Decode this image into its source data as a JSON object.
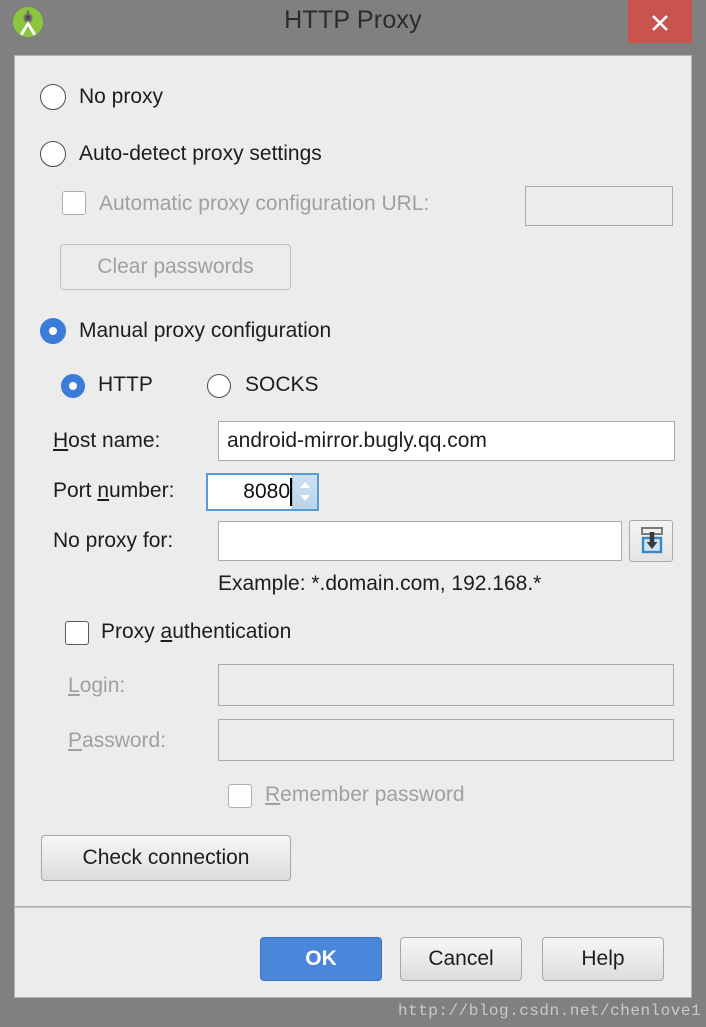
{
  "window": {
    "title": "HTTP Proxy",
    "app_icon": "android-studio-icon",
    "close_label": "×",
    "close_color": "#c9534d",
    "titlebar_color": "#808080",
    "panel_color": "#ececec"
  },
  "options": {
    "no_proxy": {
      "label": "No proxy",
      "checked": false
    },
    "auto_detect": {
      "label": "Auto-detect proxy settings",
      "checked": false
    },
    "auto_config": {
      "label": "Automatic proxy configuration URL:",
      "checked": false,
      "disabled": true,
      "url_value": "",
      "url_placeholder": ""
    },
    "clear_passwords": {
      "label": "Clear passwords",
      "disabled": true
    },
    "manual": {
      "label": "Manual proxy configuration",
      "checked": true
    },
    "protocol": {
      "http": {
        "label": "HTTP",
        "checked": true
      },
      "socks": {
        "label": "SOCKS",
        "checked": false
      }
    }
  },
  "manual_fields": {
    "host_label_pre": "H",
    "host_label_post": "ost name:",
    "host_value": "android-mirror.bugly.qq.com",
    "port_label_pre": "Port ",
    "port_label_mn": "n",
    "port_label_post": "umber:",
    "port_value": "8080",
    "no_proxy_for_label": "No proxy for:",
    "no_proxy_for_value": "",
    "load_icon": "import-tray-icon",
    "example_hint": "Example: *.domain.com, 192.168.*"
  },
  "auth": {
    "checkbox_label_pre": "Proxy ",
    "checkbox_label_mn": "a",
    "checkbox_label_post": "uthentication",
    "checked": false,
    "login_label_pre": "L",
    "login_label_post": "ogin:",
    "login_value": "",
    "password_label_pre": "P",
    "password_label_post": "assword:",
    "password_value": "",
    "remember_pre": "R",
    "remember_post": "emember password",
    "remember_checked": false
  },
  "actions": {
    "check_connection": "Check connection",
    "ok": "OK",
    "cancel": "Cancel",
    "help": "Help",
    "ok_color": "#4a86d9"
  },
  "watermark": "http://blog.csdn.net/chenlove1"
}
